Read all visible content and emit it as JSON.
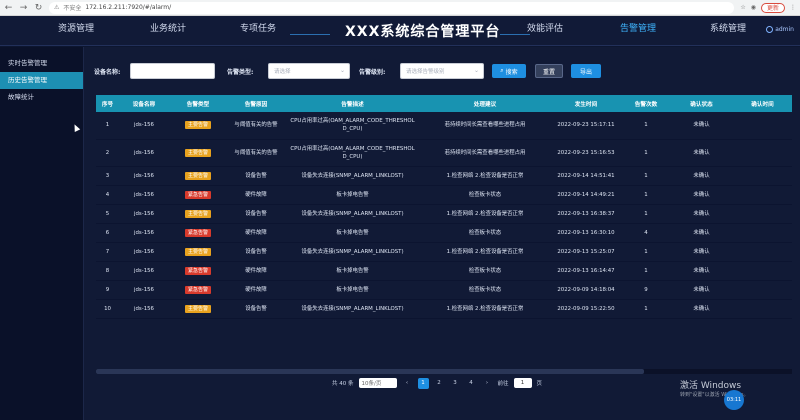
{
  "browser": {
    "insecure_label": "不安全",
    "url": "172.16.2.211:7920/#/alarm/",
    "update_label": "更新"
  },
  "header": {
    "title": "XXX系统综合管理平台",
    "nav_left": [
      "资源管理",
      "业务统计",
      "专项任务"
    ],
    "nav_right": [
      "效能评估",
      "告警管理",
      "系统管理"
    ],
    "active_nav": "告警管理",
    "user": "admin"
  },
  "sidebar": {
    "items": [
      {
        "label": "实时告警管理",
        "active": false
      },
      {
        "label": "历史告警管理",
        "active": true
      },
      {
        "label": "故障统计",
        "active": false
      }
    ]
  },
  "filters": {
    "device_name_label": "设备名称:",
    "device_name_value": "",
    "alarm_type_label": "告警类型:",
    "alarm_type_placeholder": "请选择",
    "alarm_level_label": "告警级别:",
    "alarm_level_placeholder": "请选择告警级别",
    "search_label": "搜索",
    "reset_label": "重置",
    "export_label": "导出"
  },
  "table": {
    "columns": [
      "序号",
      "设备名称",
      "告警类型",
      "告警原因",
      "告警描述",
      "处理建议",
      "发生时间",
      "告警次数",
      "确认状态",
      "确认时间"
    ],
    "rows": [
      {
        "no": "1",
        "device": "jds-156",
        "type": "主要告警",
        "level_color": "#e8a21e",
        "reason": "与阈值有关的告警",
        "desc": "CPU占用率过高(OAM_ALARM_CODE_THRESHOLD_CPU)",
        "advice": "若持续时间长需查看哪些进程占用",
        "time": "2022-09-23 15:17:11",
        "count": "1",
        "status": "未确认",
        "confirm_time": ""
      },
      {
        "no": "2",
        "device": "jds-156",
        "type": "主要告警",
        "level_color": "#e8a21e",
        "reason": "与阈值有关的告警",
        "desc": "CPU占用率过高(OAM_ALARM_CODE_THRESHOLD_CPU)",
        "advice": "若持续时间长需查看哪些进程占用",
        "time": "2022-09-23 15:16:53",
        "count": "1",
        "status": "未确认",
        "confirm_time": ""
      },
      {
        "no": "3",
        "device": "jds-156",
        "type": "主要告警",
        "level_color": "#e8a21e",
        "reason": "设备告警",
        "desc": "设备失去连接(SNMP_ALARM_LINKLOST)",
        "advice": "1.检查网络 2.检查设备是否正常",
        "time": "2022-09-14 14:51:41",
        "count": "1",
        "status": "未确认",
        "confirm_time": ""
      },
      {
        "no": "4",
        "device": "jds-156",
        "type": "紧急告警",
        "level_color": "#d83a2c",
        "reason": "硬件故障",
        "desc": "板卡掉电告警",
        "advice": "检查板卡状态",
        "time": "2022-09-14 14:49:21",
        "count": "1",
        "status": "未确认",
        "confirm_time": ""
      },
      {
        "no": "5",
        "device": "jds-156",
        "type": "主要告警",
        "level_color": "#e8a21e",
        "reason": "设备告警",
        "desc": "设备失去连接(SNMP_ALARM_LINKLOST)",
        "advice": "1.检查网络 2.检查设备是否正常",
        "time": "2022-09-13 16:38:37",
        "count": "1",
        "status": "未确认",
        "confirm_time": ""
      },
      {
        "no": "6",
        "device": "jds-156",
        "type": "紧急告警",
        "level_color": "#d83a2c",
        "reason": "硬件故障",
        "desc": "板卡掉电告警",
        "advice": "检查板卡状态",
        "time": "2022-09-13 16:30:10",
        "count": "4",
        "status": "未确认",
        "confirm_time": ""
      },
      {
        "no": "7",
        "device": "jds-156",
        "type": "主要告警",
        "level_color": "#e8a21e",
        "reason": "设备告警",
        "desc": "设备失去连接(SNMP_ALARM_LINKLOST)",
        "advice": "1.检查网络 2.检查设备是否正常",
        "time": "2022-09-13 15:25:07",
        "count": "1",
        "status": "未确认",
        "confirm_time": ""
      },
      {
        "no": "8",
        "device": "jds-156",
        "type": "紧急告警",
        "level_color": "#d83a2c",
        "reason": "硬件故障",
        "desc": "板卡掉电告警",
        "advice": "检查板卡状态",
        "time": "2022-09-13 16:14:47",
        "count": "1",
        "status": "未确认",
        "confirm_time": ""
      },
      {
        "no": "9",
        "device": "jds-156",
        "type": "紧急告警",
        "level_color": "#d83a2c",
        "reason": "硬件故障",
        "desc": "板卡掉电告警",
        "advice": "检查板卡状态",
        "time": "2022-09-09 14:18:04",
        "count": "9",
        "status": "未确认",
        "confirm_time": ""
      },
      {
        "no": "10",
        "device": "jds-156",
        "type": "主要告警",
        "level_color": "#e8a21e",
        "reason": "设备告警",
        "desc": "设备失去连接(SNMP_ALARM_LINKLOST)",
        "advice": "1.检查网络 2.检查设备是否正常",
        "time": "2022-09-09 15:22:50",
        "count": "1",
        "status": "未确认",
        "confirm_time": ""
      }
    ]
  },
  "pagination": {
    "total_label": "共 40 条",
    "page_size": "10条/页",
    "prev_icon": "‹",
    "pages": [
      "1",
      "2",
      "3",
      "4"
    ],
    "active_page": "1",
    "next_icon": "›",
    "goto_label": "前往",
    "goto_value": "1",
    "page_suffix": "页"
  },
  "overlay": {
    "windows_activate": "激活 Windows",
    "windows_activate_sub": "转到\"设置\"以激活 Windows。",
    "recorder_time": "03:11"
  },
  "colors": {
    "accent": "#1e8fe1",
    "header_row": "#1893b1",
    "major": "#e8a21e",
    "critical": "#d83a2c"
  }
}
